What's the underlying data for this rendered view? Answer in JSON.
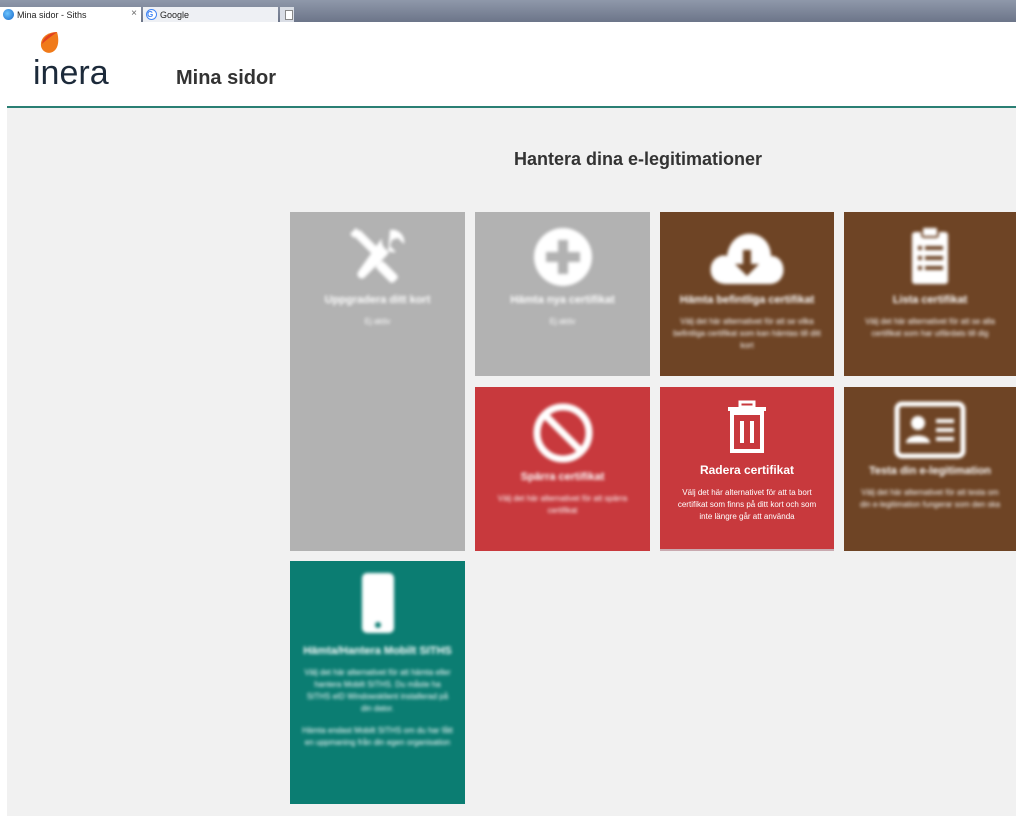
{
  "browser": {
    "tabs": [
      {
        "label": "Mina sidor - Siths",
        "icon": "ie-icon",
        "close": "×"
      },
      {
        "label": "Google",
        "icon": "google-icon",
        "close": ""
      }
    ]
  },
  "header": {
    "logo_text": "inera",
    "app_title": "Mina sidor"
  },
  "main": {
    "title": "Hantera dina e-legitimationer",
    "tiles": [
      {
        "title": "Uppgradera ditt kort",
        "desc": "Ej aktiv",
        "color": "#b2b2b2",
        "icon": "tools-icon"
      },
      {
        "title": "Hämta nya certifikat",
        "desc": "Ej aktiv",
        "color": "#b2b2b2",
        "icon": "plus-circle-icon"
      },
      {
        "title": "Hämta befintliga certifikat",
        "desc": "Välj det här alternativet för att se vilka befintliga certifikat som kan hämtas till ditt kort",
        "color": "#6e4425",
        "icon": "cloud-download-icon"
      },
      {
        "title": "Lista certifikat",
        "desc": "Välj det här alternativet för att se alla certifikat som har utfärdats till dig",
        "color": "#6e4425",
        "icon": "clipboard-list-icon"
      },
      {
        "title": "Spärra certifikat",
        "desc": "Välj det här alternativet för att spärra certifikat",
        "color": "#c8393d",
        "icon": "ban-icon"
      },
      {
        "title": "Radera certifikat",
        "desc": "Välj det här alternativet för att ta bort certifikat som finns på ditt kort och som inte längre går att använda",
        "color": "#c8393d",
        "icon": "trash-icon"
      },
      {
        "title": "Testa din e-legitimation",
        "desc": "Välj det här alternativet för att testa om din e-legitimation fungerar som den ska",
        "color": "#6e4425",
        "icon": "id-card-icon"
      },
      {
        "title": "Hämta/Hantera Mobilt SITHS",
        "desc": "Välj det här alternativet för att hämta eller hantera Mobilt SITHS. Du måste ha SITHS eID Windowsklient installerad på din dator.",
        "desc2": "Hämta endast Mobilt SITHS om du har fått en uppmaning från din egen organisation",
        "color": "#0b7d72",
        "icon": "mobile-phone-icon"
      }
    ]
  }
}
